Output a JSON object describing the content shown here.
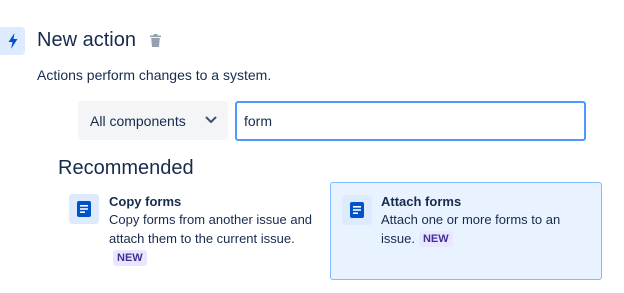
{
  "header": {
    "title": "New action",
    "subtitle": "Actions perform changes to a system."
  },
  "filter": {
    "component_select": "All components",
    "search_value": "form"
  },
  "recommended": {
    "heading": "Recommended",
    "cards": [
      {
        "title": "Copy forms",
        "description": "Copy forms from another issue and attach them to the current issue.",
        "badge": "NEW"
      },
      {
        "title": "Attach forms",
        "description": "Attach one or more forms to an issue.",
        "badge": "NEW"
      }
    ]
  },
  "colors": {
    "accent": "#0052cc",
    "selected_bg": "#e9f2ff",
    "badge_bg": "#eae6ff",
    "badge_text": "#403294"
  },
  "icons": {
    "action": "lightning-bolt-icon",
    "delete": "trash-icon",
    "dropdown": "chevron-down-icon",
    "card": "form-icon"
  }
}
